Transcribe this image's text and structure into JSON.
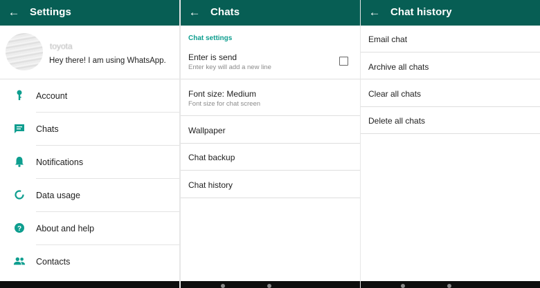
{
  "colors": {
    "appbar": "#075e54",
    "accent": "#0e9e8f",
    "icon": "#0e9e8f"
  },
  "settings_screen": {
    "title": "Settings",
    "back_icon": "arrow-left-icon",
    "profile": {
      "name": "toyota",
      "status": "Hey there! I am using WhatsApp."
    },
    "items": [
      {
        "label": "Account",
        "icon": "key-icon"
      },
      {
        "label": "Chats",
        "icon": "chat-icon"
      },
      {
        "label": "Notifications",
        "icon": "bell-icon"
      },
      {
        "label": "Data usage",
        "icon": "data-usage-icon"
      },
      {
        "label": "About and help",
        "icon": "help-icon"
      },
      {
        "label": "Contacts",
        "icon": "contacts-icon"
      }
    ]
  },
  "chats_screen": {
    "title": "Chats",
    "back_icon": "arrow-left-icon",
    "section_header": "Chat settings",
    "enter_is_send": {
      "label": "Enter is send",
      "sublabel": "Enter key will add a new line",
      "checked": false
    },
    "font_size": {
      "label": "Font size: Medium",
      "sublabel": "Font size for chat screen"
    },
    "wallpaper": {
      "label": "Wallpaper"
    },
    "chat_backup": {
      "label": "Chat backup"
    },
    "chat_history": {
      "label": "Chat history"
    }
  },
  "chat_history_screen": {
    "title": "Chat history",
    "back_icon": "arrow-left-icon",
    "items": [
      {
        "label": "Email chat"
      },
      {
        "label": "Archive all chats"
      },
      {
        "label": "Clear all chats"
      },
      {
        "label": "Delete all chats"
      }
    ]
  }
}
